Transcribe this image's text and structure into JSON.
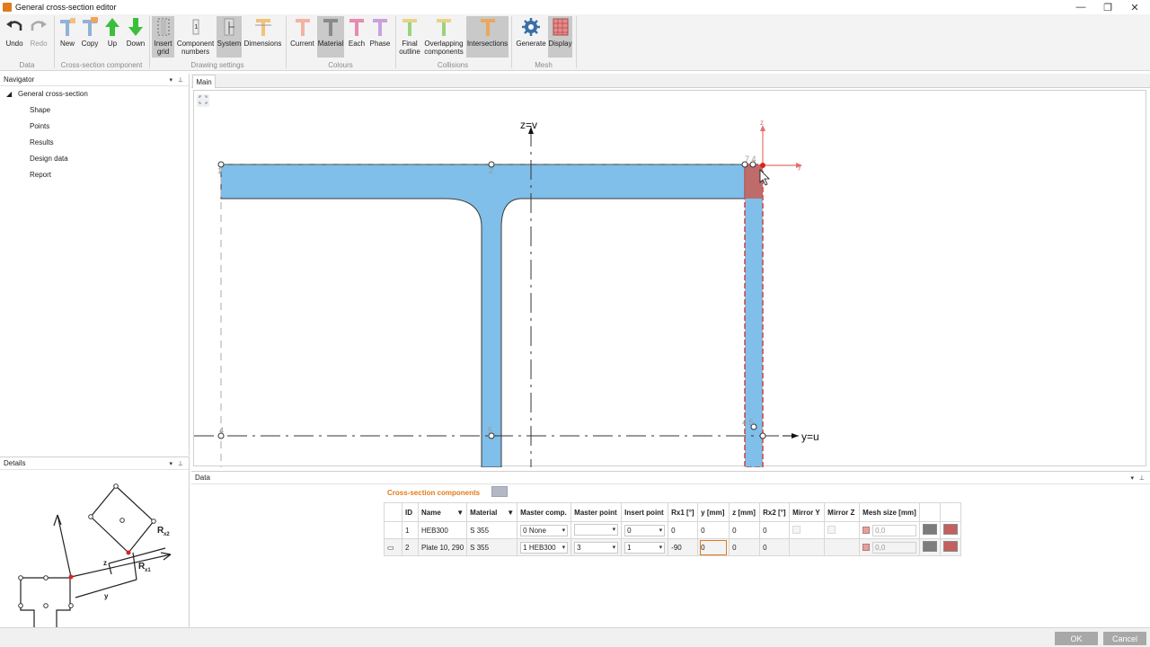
{
  "window": {
    "title": "General cross-section editor",
    "controls": {
      "minimize": "—",
      "restore": "❐",
      "close": "✕"
    }
  },
  "ribbon": {
    "data": {
      "undo": "Undo",
      "redo": "Redo",
      "group": "Data"
    },
    "component": {
      "new": "New",
      "copy": "Copy",
      "up": "Up",
      "down": "Down",
      "group": "Cross-section component"
    },
    "drawing": {
      "insert_grid": "Insert grid",
      "component_numbers": "Component numbers",
      "system": "System",
      "dimensions": "Dimensions",
      "group": "Drawing settings"
    },
    "colours": {
      "current": "Current",
      "material": "Material",
      "each": "Each",
      "phase": "Phase",
      "group": "Colours"
    },
    "collisions": {
      "final_outline": "Final outline",
      "overlapping": "Overlapping components",
      "intersections": "Intersections",
      "group": "Collisions"
    },
    "mesh": {
      "generate": "Generate",
      "display": "Display",
      "group": "Mesh"
    }
  },
  "navigator": {
    "title": "Navigator",
    "root": "General cross-section",
    "items": [
      "Shape",
      "Points",
      "Results",
      "Design data",
      "Report"
    ]
  },
  "details": {
    "title": "Details",
    "labels": {
      "rx2": "R",
      "rx2_sub": "x2",
      "rx1": "R",
      "rx1_sub": "x1",
      "y": "y",
      "z": "z"
    }
  },
  "main": {
    "tab": "Main",
    "canvas_labels": {
      "z_axis": "z=v",
      "y_axis": "y=u",
      "local_z": "z",
      "local_y": "y",
      "pt_left_top": "1",
      "pt_mid_top": "2",
      "pt_right_top": "7 4",
      "pt_left_bottom": "4",
      "pt_mid_bottom": "5",
      "pt_right_bottom": "4 5"
    }
  },
  "data_panel": {
    "title": "Data",
    "section_title": "Cross-section components",
    "columns": [
      "ID",
      "Name",
      "Material",
      "Master comp.",
      "Master point",
      "Insert point",
      "Rx1 [°]",
      "y [mm]",
      "z [mm]",
      "Rx2 [°]",
      "Mirror Y",
      "Mirror Z",
      "Mesh size [mm]"
    ],
    "rows": [
      {
        "id": "1",
        "name": "HEB300",
        "material": "S 355",
        "master_comp": "0 None",
        "master_point": "",
        "insert_point": "0",
        "rx1": "0",
        "y": "0",
        "z": "0",
        "rx2": "0",
        "mesh": "0,0"
      },
      {
        "id": "2",
        "name": "Plate 10, 290",
        "material": "S 355",
        "master_comp": "1 HEB300",
        "master_point": "3",
        "insert_point": "1",
        "rx1": "-90",
        "y": "0",
        "z": "0",
        "rx2": "0",
        "mesh": "0,0"
      }
    ]
  },
  "footer": {
    "ok": "OK",
    "cancel": "Cancel"
  },
  "colors": {
    "accent": "#e07b1c",
    "steel_fill": "#7fbfe9",
    "plate_highlight": "#d44848"
  }
}
